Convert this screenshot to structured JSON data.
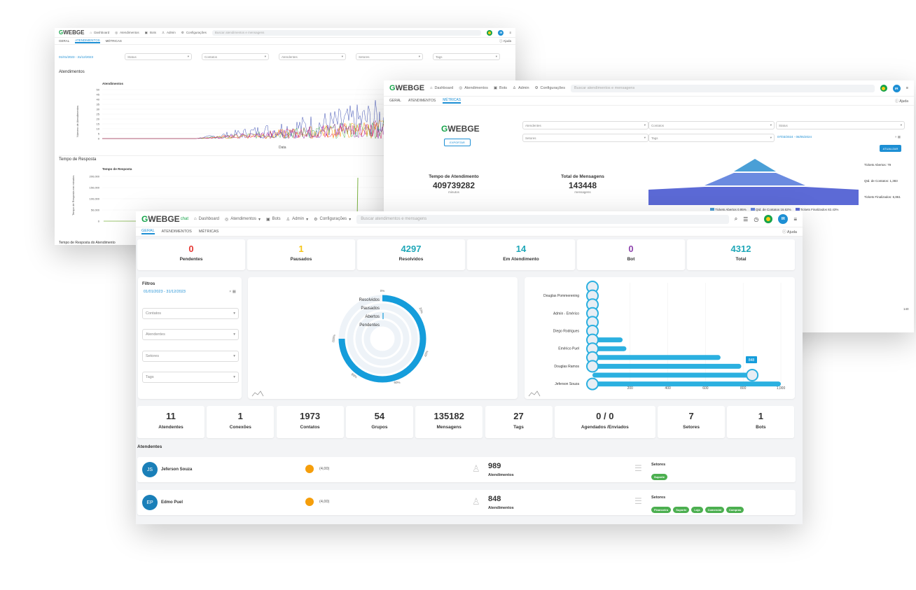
{
  "brand": {
    "logo_main": "WEBGE",
    "logo_sub": "chat"
  },
  "nav": {
    "dashboard": "Dashboard",
    "atendimentos": "Atendimentos",
    "bots": "Bots",
    "admin": "Admin",
    "configuracoes": "Configurações",
    "search_placeholder": "Buscar atendimentos e mensagens",
    "user_initials": "IR"
  },
  "tabs": [
    "GERAL",
    "ATENDIMENTOS",
    "MÉTRICAS"
  ],
  "help": "Ajuda",
  "w1": {
    "date_range": "01/01/2023 - 31/12/2023",
    "filters": [
      "Status",
      "Contatos",
      "Atendentes",
      "Setores",
      "Tags"
    ],
    "section1": "Atendimentos",
    "chart1": {
      "title": "Atendimentos",
      "ylabel": "Número de Atendimentos",
      "xlabel": "Data",
      "yticks": [
        "50",
        "45",
        "40",
        "35",
        "30",
        "25",
        "20",
        "15",
        "10",
        "5",
        "0"
      ]
    },
    "section2": "Tempo de Resposta",
    "chart2": {
      "title": "Tempo de Resposta",
      "ylabel": "Tempo de Resposta em minutos",
      "yticks": [
        "200,000",
        "150,000",
        "100,000",
        "50,000",
        "0"
      ]
    },
    "section3": "Tempo de Resposta do Atendimento"
  },
  "w2": {
    "filters_left": [
      "Atendentes",
      "Setores"
    ],
    "filters_mid": [
      "Contatos",
      "Tags"
    ],
    "filter_right": "Status",
    "date_range": "07/03/2024 - 06/05/2024",
    "export_label": "EXPORTAR",
    "update_label": "ATUALIZAR",
    "tempo": {
      "label": "Tempo de Atendimento",
      "value": "409739282",
      "unit": "minutos"
    },
    "mensagens": {
      "label": "Total de Mensagens",
      "value": "143448",
      "unit": "mensagens"
    },
    "funnel": {
      "labels": [
        "Tickets Abertos: 79",
        "Qtd. de Contatos: 1,383",
        "Tickets Finalizados: 6,861"
      ],
      "legend": [
        "Tickets Abertos 0.95%",
        "Qtd. de Contatos 16.62%",
        "Tickets Finalizados 82.43%"
      ]
    },
    "axis_tail": "140"
  },
  "w3": {
    "top_stats": [
      {
        "value": "0",
        "label": "Pendentes",
        "color": "#e53935"
      },
      {
        "value": "1",
        "label": "Pausados",
        "color": "#f5c518"
      },
      {
        "value": "4297",
        "label": "Resolvidos",
        "color": "#1fa7b8"
      },
      {
        "value": "14",
        "label": "Em Atendimento",
        "color": "#1fa7b8"
      },
      {
        "value": "0",
        "label": "Bot",
        "color": "#8e44ad"
      },
      {
        "value": "4312",
        "label": "Total",
        "color": "#1fa7b8"
      }
    ],
    "filters": {
      "title": "Filtros",
      "date": "01/01/2023 - 31/12/2023",
      "selects": [
        "Contatos",
        "Atendentes",
        "Setores",
        "Tags"
      ]
    },
    "radial": {
      "labels": [
        "Resolvidos",
        "Pausados",
        "Abertos",
        "Pendentes"
      ],
      "ticks": [
        "0%",
        "20%",
        "40%",
        "60%",
        "80%",
        "100%"
      ]
    },
    "bars": {
      "names": [
        "Douglas Pommerening",
        "Admin - Emérico",
        "Diego Rodrigues",
        "Emérico Puel",
        "Douglas Ramos",
        "Jeferson Souza"
      ],
      "ticks": [
        "0",
        "200",
        "400",
        "600",
        "800",
        "1,000"
      ],
      "tooltip": "848",
      "values": [
        null,
        null,
        160,
        180,
        680,
        790,
        848,
        1000
      ]
    },
    "bottom_stats": [
      {
        "value": "11",
        "label": "Atendentes"
      },
      {
        "value": "1",
        "label": "Conexões"
      },
      {
        "value": "1973",
        "label": "Contatos"
      },
      {
        "value": "54",
        "label": "Grupos"
      },
      {
        "value": "135182",
        "label": "Mensagens"
      },
      {
        "value": "27",
        "label": "Tags"
      },
      {
        "value": "0 / 0",
        "label": "Agendados /Enviados"
      },
      {
        "value": "7",
        "label": "Setores"
      },
      {
        "value": "1",
        "label": "Bots"
      }
    ],
    "atendentes_title": "Atendentes",
    "atendentes": [
      {
        "initials": "JS",
        "name": "Jeferson Souza",
        "rating": "(4,00)",
        "count": "989",
        "count_label": "Atendimentos",
        "setores_label": "Setores",
        "setores": [
          "Suporte"
        ]
      },
      {
        "initials": "EP",
        "name": "Edmo Puel",
        "rating": "(4,00)",
        "count": "848",
        "count_label": "Atendimentos",
        "setores_label": "Setores",
        "setores": [
          "Financeiro",
          "Suporte",
          "Loja",
          "Comercial",
          "Compras"
        ]
      }
    ]
  },
  "colors": {
    "accent": "#1d8fd4",
    "green": "#16a34a",
    "bar": "#2bb0e0"
  }
}
